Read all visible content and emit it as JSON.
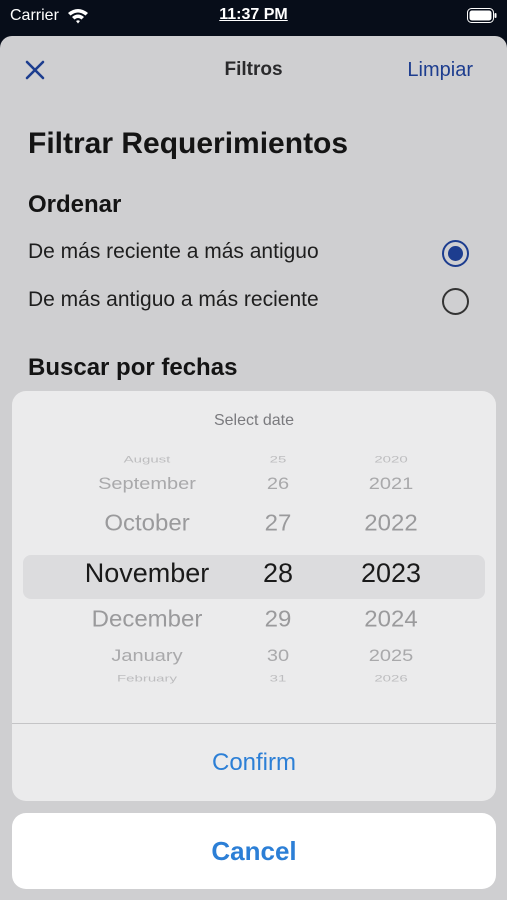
{
  "status_bar": {
    "carrier": "Carrier",
    "time": "11:37 PM",
    "icons": [
      "wifi-icon",
      "battery-icon"
    ]
  },
  "nav": {
    "close_icon": "close-icon",
    "title": "Filtros",
    "clear_label": "Limpiar"
  },
  "content": {
    "title": "Filtrar Requerimientos",
    "sort_heading": "Ordenar",
    "sort_options": [
      {
        "label": "De más reciente a más antiguo",
        "selected": true
      },
      {
        "label": "De más antiguo a más reciente",
        "selected": false
      }
    ],
    "date_heading": "Buscar por fechas"
  },
  "date_picker": {
    "header": "Select date",
    "months": [
      "August",
      "September",
      "October",
      "November",
      "December",
      "January",
      "February"
    ],
    "days": [
      "25",
      "26",
      "27",
      "28",
      "29",
      "30",
      "31"
    ],
    "years": [
      "2020",
      "2021",
      "2022",
      "2023",
      "2024",
      "2025",
      "2026"
    ],
    "selected": {
      "month": "November",
      "day": "28",
      "year": "2023"
    },
    "confirm_label": "Confirm",
    "cancel_label": "Cancel"
  },
  "colors": {
    "accent": "#1d3d8f",
    "action_blue": "#2c7fd6",
    "sheet_background": "#cfcfd1",
    "picker_background": "#ebebec"
  }
}
